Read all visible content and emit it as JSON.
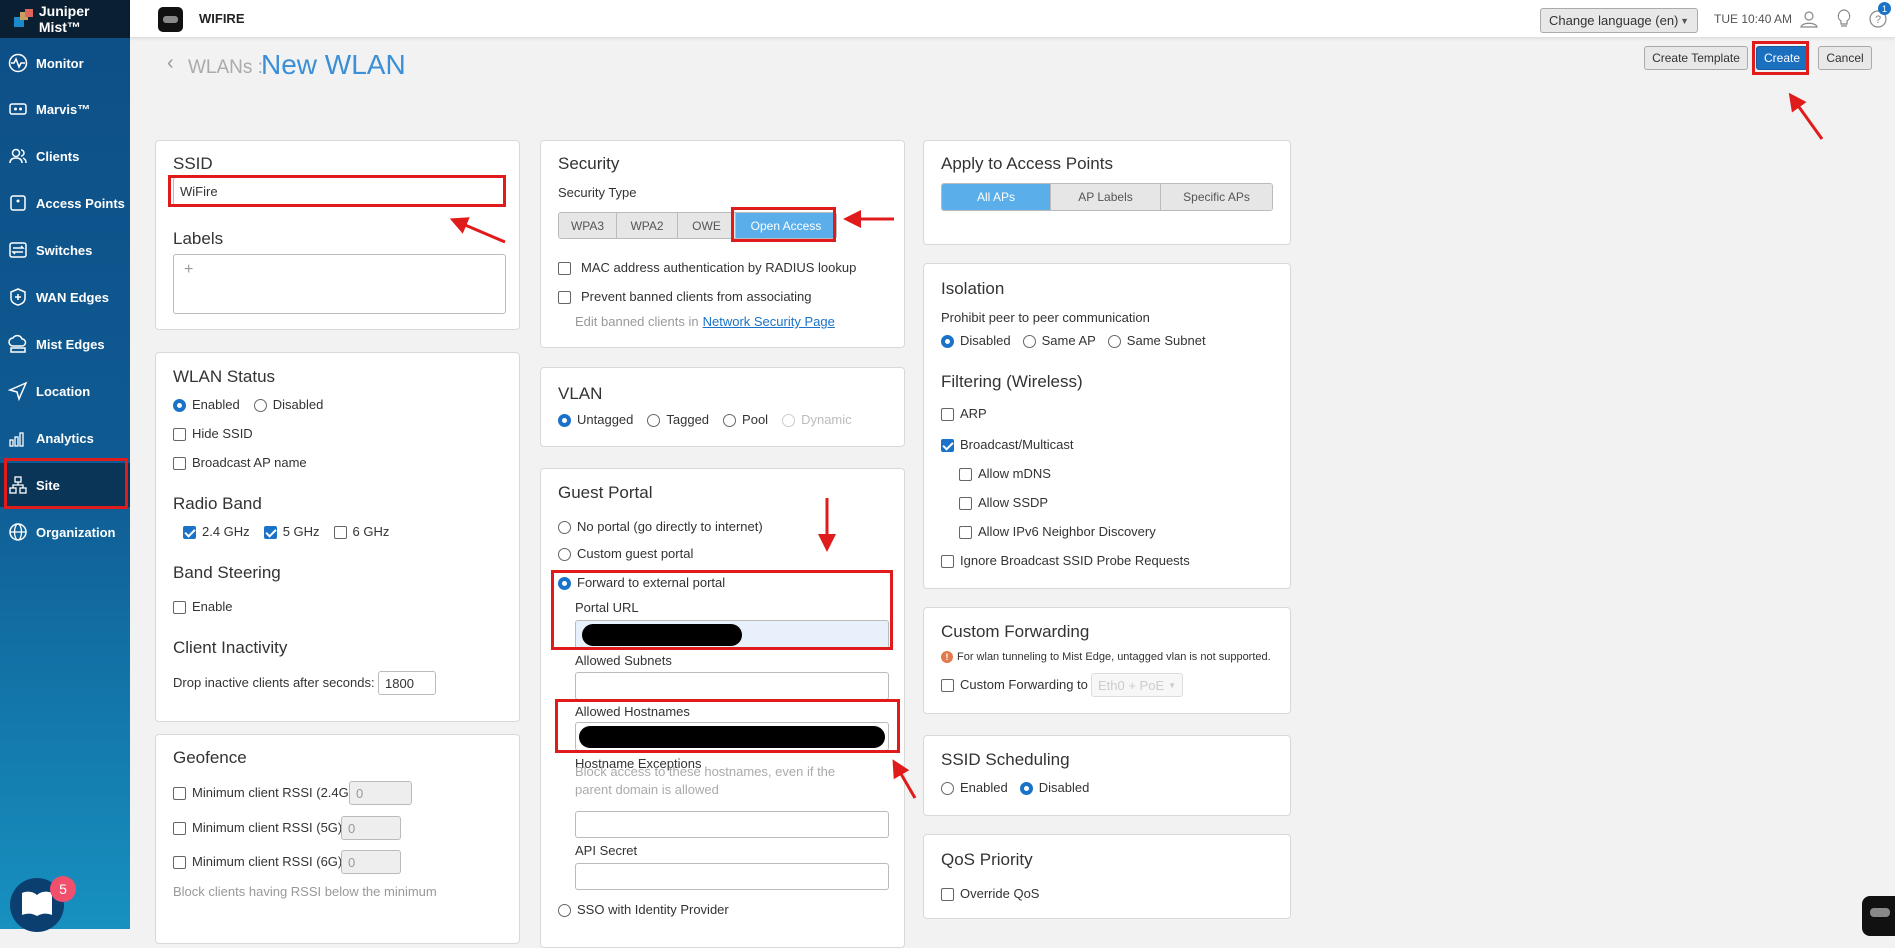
{
  "app": {
    "brand": "Juniper Mist™",
    "org": "WIFIRE"
  },
  "sidebar": {
    "items": [
      {
        "label": "Monitor"
      },
      {
        "label": "Marvis™"
      },
      {
        "label": "Clients"
      },
      {
        "label": "Access Points"
      },
      {
        "label": "Switches"
      },
      {
        "label": "WAN Edges"
      },
      {
        "label": "Mist Edges"
      },
      {
        "label": "Location"
      },
      {
        "label": "Analytics"
      },
      {
        "label": "Site"
      },
      {
        "label": "Organization"
      }
    ],
    "book_badge": "5"
  },
  "topbar": {
    "language": "Change language (en)",
    "time": "TUE 10:40 AM",
    "help_badge": "1"
  },
  "page": {
    "breadcrumb": "WLANs :",
    "title": "New WLAN",
    "create_template": "Create Template",
    "create": "Create",
    "cancel": "Cancel"
  },
  "ssid": {
    "title": "SSID",
    "value": "WiFire",
    "labels_title": "Labels",
    "add": "+"
  },
  "status": {
    "title": "WLAN Status",
    "enabled": "Enabled",
    "disabled": "Disabled",
    "hide": "Hide SSID",
    "broadcast": "Broadcast AP name",
    "radio_title": "Radio Band",
    "b24": "2.4 GHz",
    "b5": "5 GHz",
    "b6": "6 GHz",
    "steer_title": "Band Steering",
    "steer_enable": "Enable",
    "inact_title": "Client Inactivity",
    "inact_label": "Drop inactive clients after seconds:",
    "inact_value": "1800"
  },
  "geofence": {
    "title": "Geofence",
    "r24": "Minimum client RSSI (2.4G)",
    "r5": "Minimum client RSSI (5G)",
    "r6": "Minimum client RSSI (6G)",
    "v24": "0",
    "v5": "0",
    "v6": "0",
    "note": "Block clients having RSSI below the minimum"
  },
  "security": {
    "title": "Security",
    "type_label": "Security Type",
    "types": [
      "WPA3",
      "WPA2",
      "OWE",
      "Open Access"
    ],
    "mac": "MAC address authentication by RADIUS lookup",
    "prevent": "Prevent banned clients from associating",
    "edit_prefix": "Edit banned clients in",
    "edit_link": "Network Security Page"
  },
  "vlan": {
    "title": "VLAN",
    "untagged": "Untagged",
    "tagged": "Tagged",
    "pool": "Pool",
    "dynamic": "Dynamic"
  },
  "portal": {
    "title": "Guest Portal",
    "none": "No portal (go directly to internet)",
    "custom": "Custom guest portal",
    "forward": "Forward to external portal",
    "url_label": "Portal URL",
    "subnets_label": "Allowed Subnets",
    "hosts_label": "Allowed Hostnames",
    "exc_label": "Hostname Exceptions",
    "exc_help": "Block access to these hostnames, even if the parent domain is allowed",
    "api_label": "API Secret",
    "sso": "SSO with Identity Provider"
  },
  "apply": {
    "title": "Apply to Access Points",
    "options": [
      "All APs",
      "AP Labels",
      "Specific APs"
    ]
  },
  "isolation": {
    "title": "Isolation",
    "prohibit": "Prohibit peer to peer communication",
    "disabled": "Disabled",
    "same_ap": "Same AP",
    "same_subnet": "Same Subnet",
    "filter_title": "Filtering (Wireless)",
    "arp": "ARP",
    "bcast": "Broadcast/Multicast",
    "mdns": "Allow mDNS",
    "ssdp": "Allow SSDP",
    "ipv6": "Allow IPv6 Neighbor Discovery",
    "ignore": "Ignore Broadcast SSID Probe Requests"
  },
  "forwarding": {
    "title": "Custom Forwarding",
    "warning": "For wlan tunneling to Mist Edge, untagged vlan is not supported.",
    "label": "Custom Forwarding to",
    "select": "Eth0 + PoE"
  },
  "schedule": {
    "title": "SSID Scheduling",
    "enabled": "Enabled",
    "disabled": "Disabled"
  },
  "qos": {
    "title": "QoS Priority",
    "override": "Override QoS"
  },
  "colors": {
    "accent": "#1a73c8",
    "annotation": "#e01b1b"
  }
}
